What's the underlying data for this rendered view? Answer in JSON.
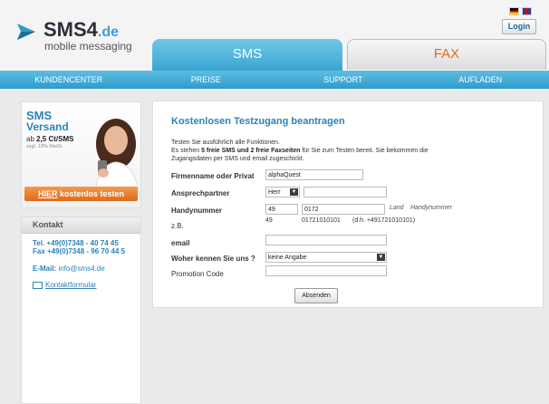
{
  "header": {
    "logo_main": "SMS4",
    "logo_tld": ".de",
    "logo_sub": "mobile messaging",
    "login_label": "Login",
    "flags": [
      "flag-de-icon",
      "flag-uk-icon"
    ]
  },
  "tabs": {
    "sms": "SMS",
    "fax": "FAX"
  },
  "nav": [
    "KUNDENCENTER",
    "PREISE",
    "SUPPORT",
    "AUFLADEN"
  ],
  "promo": {
    "title1": "SMS",
    "title2": "Versand",
    "price_prefix": "ab ",
    "price": "2,5 Ct/SMS",
    "vat": "zzgl. 19% MwSt.",
    "button_hier": "HIER",
    "button_rest": " kostenlos testen"
  },
  "contact": {
    "heading": "Kontakt",
    "tel": "Tel. +49(0)7348 - 40 74 45",
    "fax": "Fax +49(0)7348 - 96 70 44 5",
    "email_label": "E-Mail: ",
    "email": "info@sms4.de",
    "form_link": "Kontaktformular"
  },
  "form": {
    "title": "Kostenlosen Testzugang beantragen",
    "intro_1": "Testen Sie ausführlich alle Funktionen.",
    "intro_2a": "Es stehen ",
    "intro_2b": "5 freie SMS und 2 freie Faxseiten",
    "intro_2c": " für Sie zum Testen bereit. Sie bekommen die",
    "intro_3": "Zugangsdaten per SMS und email zugeschickt.",
    "company_label": "Firmenname oder Privat",
    "company_value": "alphaQuest",
    "contact_label": "Ansprechpartner",
    "salutation": "Herr",
    "contact_value": "",
    "mobile_label": "Handynummer",
    "country_code": "49",
    "prefix": "0172",
    "number": "",
    "land_hint": "Land",
    "mobile_hint": "Handynummer",
    "example_label": "z.B.",
    "example_cc": "49",
    "example_num": "01721010101",
    "example_full": "(d.h. +491721010101)",
    "email_label": "email",
    "email_value": "",
    "source_label": "Woher kennen Sie uns ?",
    "source_value": "keine Angabe",
    "promo_label": "Promotion Code",
    "promo_value": "",
    "submit": "Absenden"
  }
}
